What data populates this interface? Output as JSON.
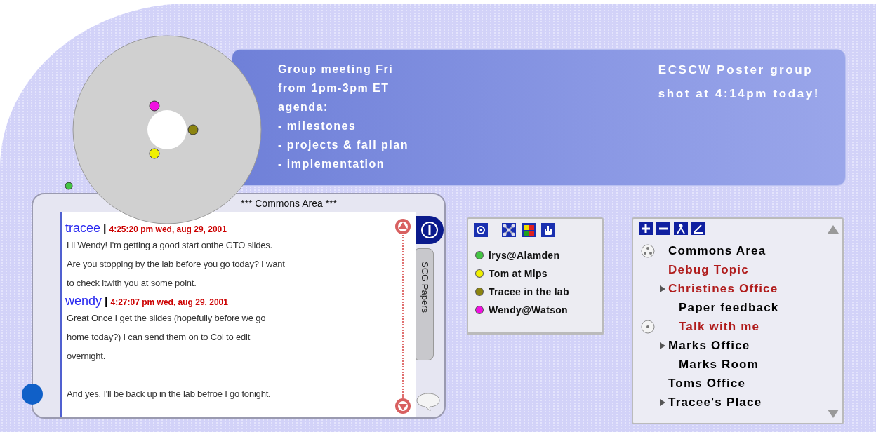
{
  "banner": {
    "notes": [
      {
        "text": "Group meeting Fri\nfrom 1pm-3pm ET\nagenda:\n- milestones\n- projects & fall plan\n- implementation"
      },
      {
        "text": "ECSCW Poster group\nshot at 4:14pm today!"
      }
    ]
  },
  "chat": {
    "title": "*** Commons Area ***",
    "messages": [
      {
        "author": "tracee",
        "separator": "|",
        "time": "4:25:20 pm wed, aug 29, 2001",
        "text": "Hi Wendy! I'm getting a good start onthe GTO slides.\nAre you stopping by the lab before you go today? I want\nto check itwith you at some point."
      },
      {
        "author": "wendy",
        "separator": "|",
        "time": "4:27:07 pm wed, aug 29, 2001",
        "text": "Great Once I get the slides (hopefully before we go\nhome today?) I can send them on to Col to edit\novernight.\n\nAnd yes, I'll be back up in the lab befroe I go tonight."
      }
    ],
    "tabs": [
      {
        "kind": "icon",
        "selected": true
      },
      {
        "kind": "text",
        "label": "SCG Papers",
        "selected": false
      }
    ]
  },
  "presence": {
    "people": [
      {
        "name": "lrys@Alamden",
        "color": "#44c444",
        "in_circle": false
      },
      {
        "name": "Tom at Mlps",
        "color": "#f0f000",
        "in_circle": true
      },
      {
        "name": "Tracee in the lab",
        "color": "#8c8410",
        "in_circle": true
      },
      {
        "name": "Wendy@Watson",
        "color": "#f010e0",
        "in_circle": true
      }
    ]
  },
  "rooms": {
    "items": [
      {
        "name": "Commons Area",
        "color": "#000000",
        "kind": "group"
      },
      {
        "name": "Debug Topic",
        "color": "#b01c1c",
        "kind": "room"
      },
      {
        "name": "Christines Office",
        "color": "#b01c1c",
        "kind": "room",
        "expandable": true,
        "children": [
          {
            "name": "Paper feedback",
            "color": "#000000",
            "kind": "room"
          },
          {
            "name": "Talk with me",
            "color": "#b01c1c",
            "kind": "occupied"
          }
        ]
      },
      {
        "name": "Marks Office",
        "color": "#000000",
        "kind": "room",
        "expandable": true,
        "children": [
          {
            "name": "Marks Room",
            "color": "#000000",
            "kind": "room"
          }
        ]
      },
      {
        "name": "Toms Office",
        "color": "#000000",
        "kind": "room"
      },
      {
        "name": "Tracee's Place",
        "color": "#000000",
        "kind": "room",
        "expandable": true
      }
    ]
  }
}
